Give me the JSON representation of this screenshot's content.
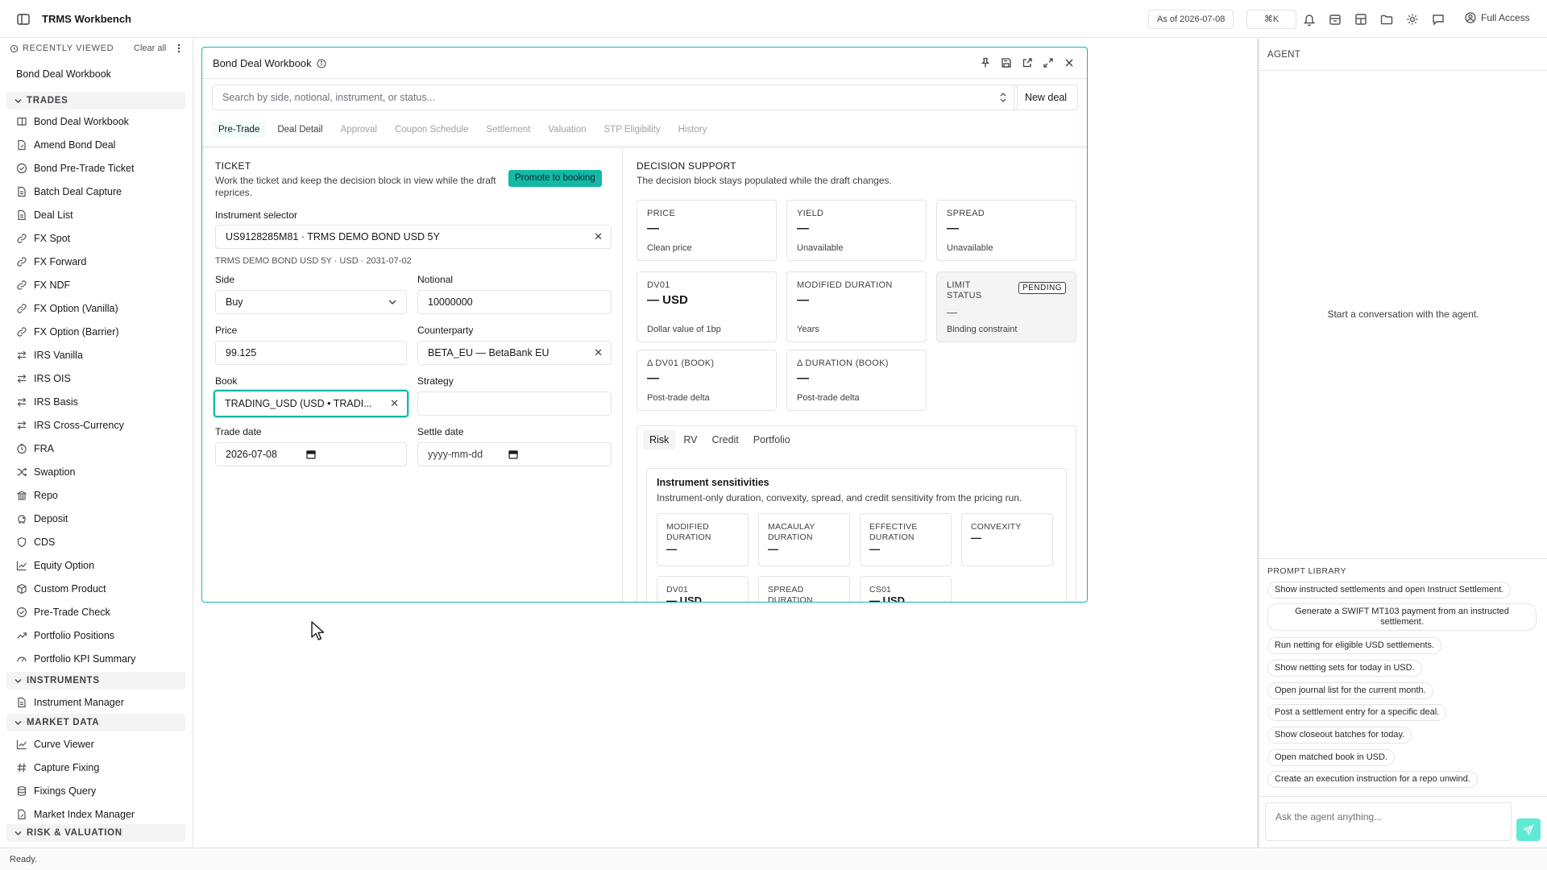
{
  "app": {
    "title": "TRMS Workbench",
    "as_of": "As of 2026-07-08",
    "shortcut": "⌘K",
    "access": "Full Access",
    "accent": "#14b8a6"
  },
  "sidebar": {
    "recent_header": "RECENTLY VIEWED",
    "clear_all": "Clear all",
    "recent_items": [
      "Bond Deal Workbook"
    ],
    "sections": [
      {
        "title": "TRADES",
        "items": [
          {
            "label": "Bond Deal Workbook",
            "icon": "book-icon"
          },
          {
            "label": "Amend Bond Deal",
            "icon": "file-edit-icon"
          },
          {
            "label": "Bond Pre-Trade Ticket",
            "icon": "check-circle-icon"
          },
          {
            "label": "Batch Deal Capture",
            "icon": "file-icon"
          },
          {
            "label": "Deal List",
            "icon": "file-icon"
          },
          {
            "label": "FX Spot",
            "icon": "link-icon"
          },
          {
            "label": "FX Forward",
            "icon": "link-icon"
          },
          {
            "label": "FX NDF",
            "icon": "link-icon"
          },
          {
            "label": "FX Option (Vanilla)",
            "icon": "link-icon"
          },
          {
            "label": "FX Option (Barrier)",
            "icon": "link-icon"
          },
          {
            "label": "IRS Vanilla",
            "icon": "swap-icon"
          },
          {
            "label": "IRS OIS",
            "icon": "swap-icon"
          },
          {
            "label": "IRS Basis",
            "icon": "swap-icon"
          },
          {
            "label": "IRS Cross-Currency",
            "icon": "swap-icon"
          },
          {
            "label": "FRA",
            "icon": "clock-icon"
          },
          {
            "label": "Swaption",
            "icon": "shuffle-icon"
          },
          {
            "label": "Repo",
            "icon": "bank-icon"
          },
          {
            "label": "Deposit",
            "icon": "piggy-bank-icon"
          },
          {
            "label": "CDS",
            "icon": "shield-icon"
          },
          {
            "label": "Equity Option",
            "icon": "chart-line-icon"
          },
          {
            "label": "Custom Product",
            "icon": "box-icon"
          },
          {
            "label": "Pre-Trade Check",
            "icon": "check-circle-icon"
          },
          {
            "label": "Portfolio Positions",
            "icon": "trend-icon"
          },
          {
            "label": "Portfolio KPI Summary",
            "icon": "gauge-icon"
          }
        ]
      },
      {
        "title": "INSTRUMENTS",
        "items": [
          {
            "label": "Instrument Manager",
            "icon": "file-icon"
          }
        ]
      },
      {
        "title": "MARKET DATA",
        "items": [
          {
            "label": "Curve Viewer",
            "icon": "chart-line-icon"
          },
          {
            "label": "Capture Fixing",
            "icon": "hash-icon"
          },
          {
            "label": "Fixings Query",
            "icon": "database-icon"
          },
          {
            "label": "Market Index Manager",
            "icon": "file-edit-icon"
          }
        ]
      },
      {
        "title": "RISK & VALUATION",
        "items": []
      }
    ]
  },
  "window": {
    "title": "Bond Deal Workbook",
    "search_placeholder": "Search by side, notional, instrument, or status...",
    "new_deal": "New deal",
    "tabs": [
      "Pre-Trade",
      "Deal Detail",
      "Approval",
      "Coupon Schedule",
      "Settlement",
      "Valuation",
      "STP Eligibility",
      "History"
    ],
    "active_tab": "Pre-Trade"
  },
  "ticket": {
    "title": "TICKET",
    "description": "Work the ticket and keep the decision block in view while the draft reprices.",
    "promote": "Promote to booking",
    "instrument_label": "Instrument selector",
    "instrument_value": "US9128285M81 · TRMS DEMO BOND USD 5Y",
    "instrument_sub": "TRMS DEMO BOND USD 5Y · USD · 2031-07-02",
    "side_label": "Side",
    "side_value": "Buy",
    "notional_label": "Notional",
    "notional_value": "10000000",
    "price_label": "Price",
    "price_value": "99.125",
    "counterparty_label": "Counterparty",
    "counterparty_value": "BETA_EU — BetaBank EU",
    "book_label": "Book",
    "book_value": "TRADING_USD (USD • TRADI...",
    "strategy_label": "Strategy",
    "strategy_value": "",
    "trade_date_label": "Trade date",
    "trade_date_value": "2026-07-08",
    "settle_date_label": "Settle date",
    "settle_date_value": "yyyy-mm-dd"
  },
  "decision": {
    "title": "DECISION SUPPORT",
    "description": "The decision block stays populated while the draft changes.",
    "cards": [
      {
        "label": "PRICE",
        "value": "—",
        "sub": "Clean price"
      },
      {
        "label": "YIELD",
        "value": "—",
        "sub": "Unavailable"
      },
      {
        "label": "SPREAD",
        "value": "—",
        "sub": "Unavailable"
      },
      {
        "label": "DV01",
        "value": "— USD",
        "sub": "Dollar value of 1bp"
      },
      {
        "label": "MODIFIED DURATION",
        "value": "—",
        "sub": "Years"
      },
      {
        "label": "LIMIT STATUS",
        "value": "—",
        "sub": "Binding constraint",
        "badge": "PENDING"
      },
      {
        "label": "Δ DV01 (BOOK)",
        "value": "—",
        "sub": "Post-trade delta"
      },
      {
        "label": "Δ DURATION (BOOK)",
        "value": "—",
        "sub": "Post-trade delta"
      }
    ],
    "subtabs": [
      "Risk",
      "RV",
      "Credit",
      "Portfolio"
    ],
    "active_subtab": "Risk",
    "sensitivities_title": "Instrument sensitivities",
    "sensitivities_desc": "Instrument-only duration, convexity, spread, and credit sensitivity from the pricing run.",
    "sens_cards": [
      {
        "label": "MODIFIED DURATION",
        "value": "—"
      },
      {
        "label": "MACAULAY DURATION",
        "value": "—"
      },
      {
        "label": "EFFECTIVE DURATION",
        "value": "—"
      },
      {
        "label": "CONVEXITY",
        "value": "—"
      },
      {
        "label": "DV01",
        "value": "— USD"
      },
      {
        "label": "SPREAD DURATION",
        "value": "—"
      },
      {
        "label": "CS01",
        "value": "— USD"
      }
    ]
  },
  "agent": {
    "title": "AGENT",
    "empty": "Start a conversation with the agent.",
    "prompt_library_title": "PROMPT LIBRARY",
    "prompts": [
      "Show instructed settlements and open Instruct Settlement.",
      "Generate a SWIFT MT103 payment from an instructed settlement.",
      "Run netting for eligible USD settlements.",
      "Show netting sets for today in USD.",
      "Open journal list for the current month.",
      "Post a settlement entry for a specific deal.",
      "Show closeout batches for today.",
      "Open matched book in USD.",
      "Create an execution instruction for a repo unwind."
    ],
    "ask_placeholder": "Ask the agent anything..."
  },
  "status": {
    "text": "Ready."
  }
}
